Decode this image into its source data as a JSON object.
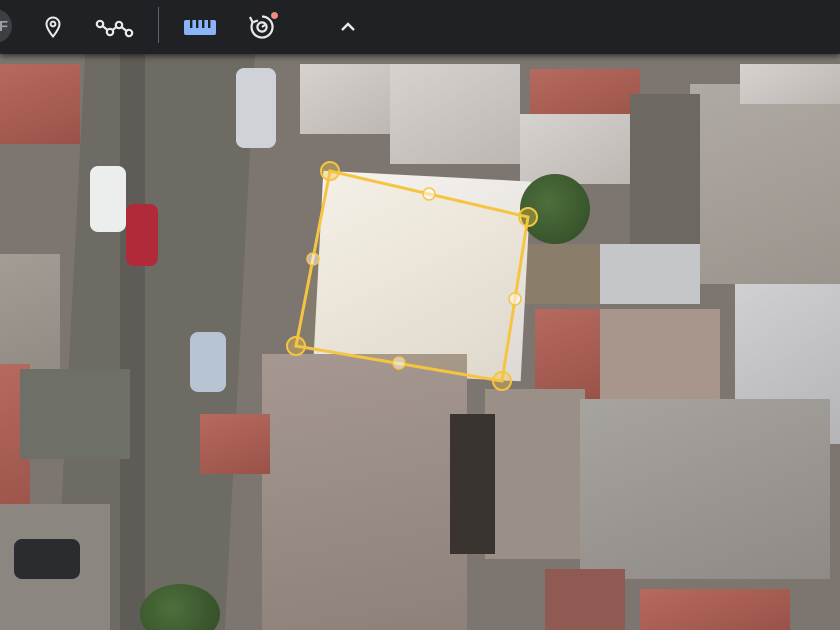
{
  "toolbar": {
    "avatar_letters": "AF",
    "tools": [
      {
        "name": "add-placemark-button",
        "icon": "location-pin-icon"
      },
      {
        "name": "draw-path-button",
        "icon": "path-polyline-icon"
      },
      {
        "name": "measure-button",
        "icon": "ruler-icon",
        "active": true
      },
      {
        "name": "historical-imagery-button",
        "icon": "history-icon",
        "has_notification": true
      },
      {
        "name": "collapse-toolbar-button",
        "icon": "chevron-up-icon"
      }
    ]
  },
  "colors": {
    "toolbar_bg": "#202124",
    "icon": "#e8eaed",
    "accent": "#8ab4f8",
    "notification": "#f28b82",
    "measure_outline": "#f5c542"
  },
  "measurement": {
    "shape": "polygon",
    "vertex_count": 4
  }
}
